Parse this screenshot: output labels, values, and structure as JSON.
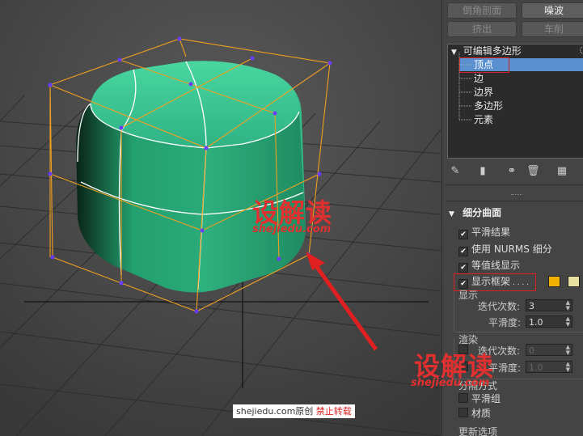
{
  "toolbar": {
    "bevel_section": "倒角剖面",
    "noise": "噪波",
    "extrude": "挤出",
    "lathe": "车削"
  },
  "stack": {
    "root": "可编辑多边形",
    "items": [
      "顶点",
      "边",
      "边界",
      "多边形",
      "元素"
    ],
    "selected": "顶点"
  },
  "rollout": {
    "title": "细分曲面",
    "smooth_result": "平滑结果",
    "use_nurms": "使用 NURMS 细分",
    "isoline_display": "等值线显示",
    "show_cage": "显示框架",
    "show_cage_dots": ". . . .",
    "cage_color_1": "#f0b000",
    "cage_color_2": "#e8e0a0",
    "display_group": "显示",
    "iterations_label": "迭代次数:",
    "iterations_value": "3",
    "smoothness_label": "平滑度:",
    "smoothness_value": "1.0",
    "render_group": "渲染",
    "render_iterations_label": "迭代次数:",
    "render_iterations_value": "0",
    "render_smoothness_label": "平滑度:",
    "render_smoothness_value": "1.0",
    "separate_by_group": "分隔方式",
    "smoothing_groups": "平滑组",
    "materials": "材质",
    "update_options": "更新选项"
  },
  "watermark": {
    "logo": "设解读",
    "url": "shejiedu.com"
  },
  "footer": {
    "site": "shejiedu.com原创",
    "notice": "禁止转载"
  },
  "colors": {
    "object": "#2fb080",
    "cage": "#f0a020",
    "vertex": "#6a3cff",
    "selection_highlight": "#5a8fd0",
    "annotation": "#e02020"
  }
}
